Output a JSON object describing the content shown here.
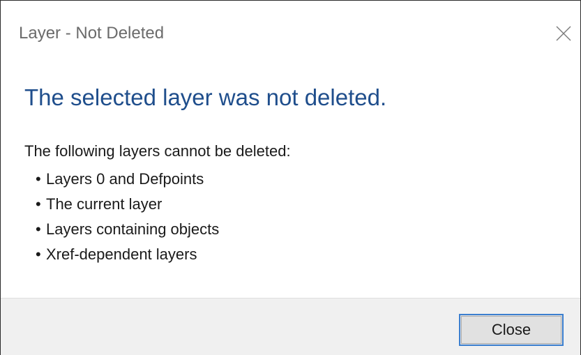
{
  "dialog": {
    "title": "Layer - Not Deleted",
    "close_icon": "close-icon"
  },
  "content": {
    "heading": "The selected layer was not deleted.",
    "intro": "The following layers cannot be deleted:",
    "bullets": [
      "Layers 0 and Defpoints",
      "The current layer",
      "Layers containing objects",
      "Xref-dependent layers"
    ]
  },
  "footer": {
    "close_label": "Close"
  },
  "colors": {
    "heading": "#1f4e8c",
    "button_focus_border": "#3c7fcf",
    "footer_bg": "#f0f0f0"
  }
}
